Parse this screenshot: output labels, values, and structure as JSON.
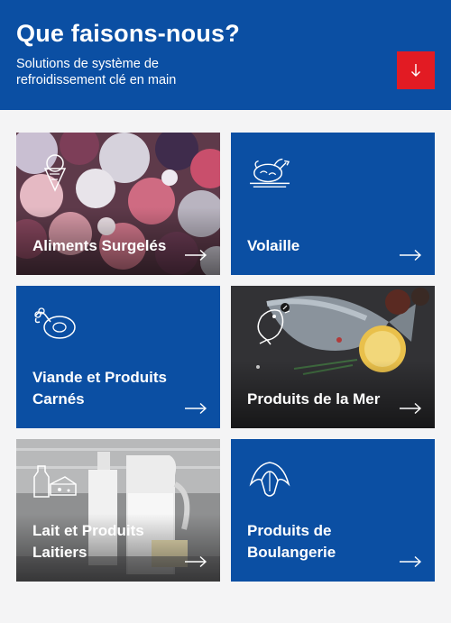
{
  "header": {
    "title": "Que faisons-nous?",
    "subtitle": "Solutions de système de refroidissement clé en main",
    "scroll_button_icon": "arrow-down-icon",
    "background_color": "#0b4fa3",
    "accent_color": "#e21b23"
  },
  "cards": [
    {
      "label": "Aliments Surgelés",
      "icon": "ice-cream-cone-icon",
      "style": "photo",
      "photo": "frozen berries and ice cream"
    },
    {
      "label": "Volaille",
      "icon": "roast-chicken-icon",
      "style": "blue"
    },
    {
      "label": "Viande et Produits Carnés",
      "icon": "meat-steak-icon",
      "style": "blue"
    },
    {
      "label": "Produits de la Mer",
      "icon": "fish-icon",
      "style": "photo",
      "photo": "fish on dark slate with lemon"
    },
    {
      "label": "Lait et Produits Laitiers",
      "icon": "milk-cheese-icon",
      "style": "photo",
      "photo": "milk bottles and jug"
    },
    {
      "label": "Produits de Boulangerie",
      "icon": "croissant-icon",
      "style": "blue"
    }
  ]
}
